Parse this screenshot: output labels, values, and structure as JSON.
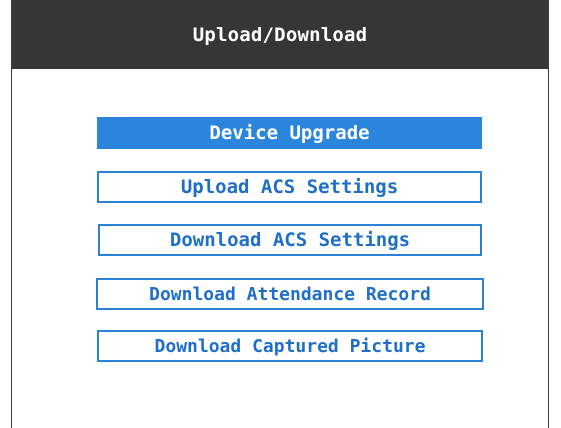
{
  "window": {
    "title": "Upload/Download"
  },
  "menu": {
    "items": [
      {
        "label": "Device Upgrade",
        "selected": true
      },
      {
        "label": "Upload ACS Settings",
        "selected": false
      },
      {
        "label": "Download ACS Settings",
        "selected": false
      },
      {
        "label": "Download Attendance Record",
        "selected": false
      },
      {
        "label": "Download Captured Picture",
        "selected": false
      }
    ]
  },
  "colors": {
    "title_bar_bg": "#363637",
    "accent": "#2b85dc",
    "item_text": "#1f6fc9"
  }
}
